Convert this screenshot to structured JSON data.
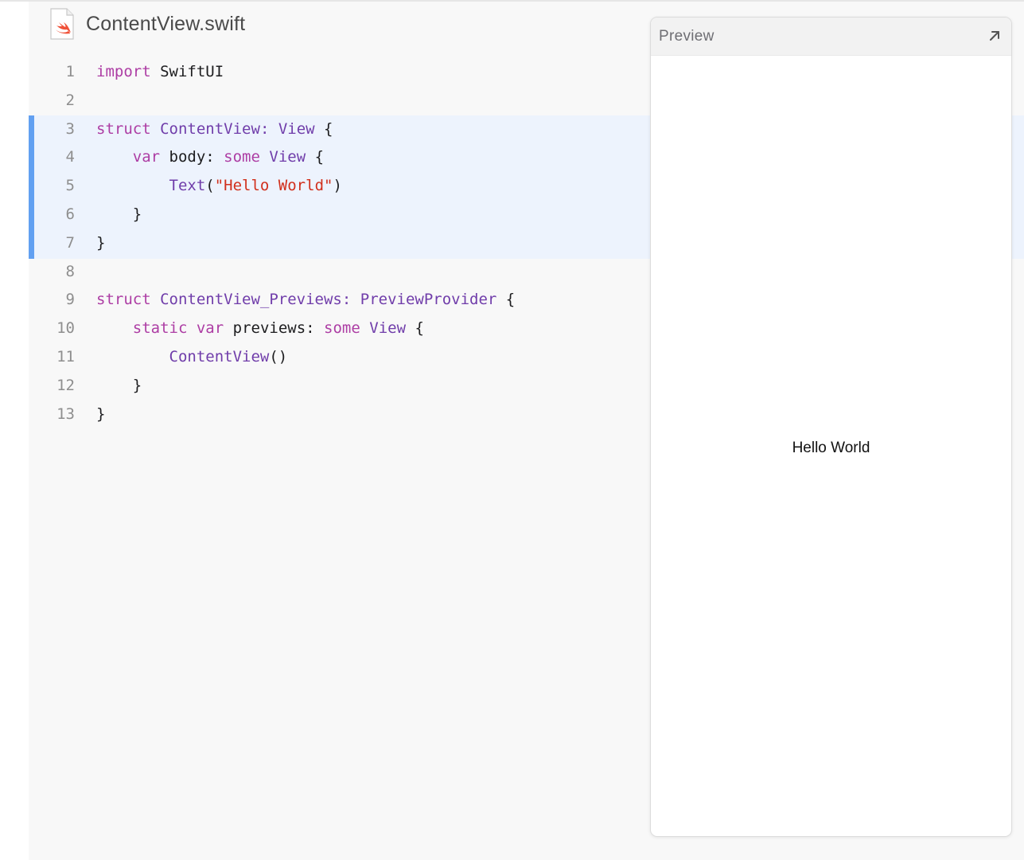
{
  "file": {
    "name": "ContentView.swift",
    "icon": "swift-file-icon"
  },
  "code": {
    "highlighted_lines": [
      3,
      7
    ],
    "lines": [
      {
        "num": "1",
        "tokens": [
          {
            "t": "import",
            "k": "keyword"
          },
          {
            "t": " SwiftUI",
            "k": "plain"
          }
        ]
      },
      {
        "num": "2",
        "tokens": []
      },
      {
        "num": "3",
        "tokens": [
          {
            "t": "struct",
            "k": "keyword"
          },
          {
            "t": " ",
            "k": "plain"
          },
          {
            "t": "ContentView",
            "k": "type"
          },
          {
            "t": ": ",
            "k": "type"
          },
          {
            "t": "View",
            "k": "type"
          },
          {
            "t": " {",
            "k": "plain"
          }
        ]
      },
      {
        "num": "4",
        "tokens": [
          {
            "t": "    ",
            "k": "plain"
          },
          {
            "t": "var",
            "k": "keyword"
          },
          {
            "t": " body: ",
            "k": "plain"
          },
          {
            "t": "some",
            "k": "keyword"
          },
          {
            "t": " ",
            "k": "plain"
          },
          {
            "t": "View",
            "k": "type"
          },
          {
            "t": " {",
            "k": "plain"
          }
        ]
      },
      {
        "num": "5",
        "tokens": [
          {
            "t": "        ",
            "k": "plain"
          },
          {
            "t": "Text",
            "k": "type"
          },
          {
            "t": "(",
            "k": "plain"
          },
          {
            "t": "\"Hello World\"",
            "k": "string"
          },
          {
            "t": ")",
            "k": "plain"
          }
        ]
      },
      {
        "num": "6",
        "tokens": [
          {
            "t": "    }",
            "k": "plain"
          }
        ]
      },
      {
        "num": "7",
        "tokens": [
          {
            "t": "}",
            "k": "plain"
          }
        ]
      },
      {
        "num": "8",
        "tokens": []
      },
      {
        "num": "9",
        "tokens": [
          {
            "t": "struct",
            "k": "keyword"
          },
          {
            "t": " ",
            "k": "plain"
          },
          {
            "t": "ContentView_Previews",
            "k": "type"
          },
          {
            "t": ": ",
            "k": "type"
          },
          {
            "t": "PreviewProvider",
            "k": "type"
          },
          {
            "t": " {",
            "k": "plain"
          }
        ]
      },
      {
        "num": "10",
        "tokens": [
          {
            "t": "    ",
            "k": "plain"
          },
          {
            "t": "static",
            "k": "keyword"
          },
          {
            "t": " ",
            "k": "plain"
          },
          {
            "t": "var",
            "k": "keyword"
          },
          {
            "t": " previews: ",
            "k": "plain"
          },
          {
            "t": "some",
            "k": "keyword"
          },
          {
            "t": " ",
            "k": "plain"
          },
          {
            "t": "View",
            "k": "type"
          },
          {
            "t": " {",
            "k": "plain"
          }
        ]
      },
      {
        "num": "11",
        "tokens": [
          {
            "t": "        ",
            "k": "plain"
          },
          {
            "t": "ContentView",
            "k": "type"
          },
          {
            "t": "()",
            "k": "plain"
          }
        ]
      },
      {
        "num": "12",
        "tokens": [
          {
            "t": "    }",
            "k": "plain"
          }
        ]
      },
      {
        "num": "13",
        "tokens": [
          {
            "t": "}",
            "k": "plain"
          }
        ]
      }
    ]
  },
  "preview": {
    "title": "Preview",
    "expand_icon": "expand-arrow-icon",
    "content_text": "Hello World"
  },
  "colors": {
    "keyword": "#ad3da4",
    "type": "#703daa",
    "string": "#d12f1b",
    "highlight_bar": "#62a0f1",
    "highlight_bg": "#edf3fd"
  }
}
